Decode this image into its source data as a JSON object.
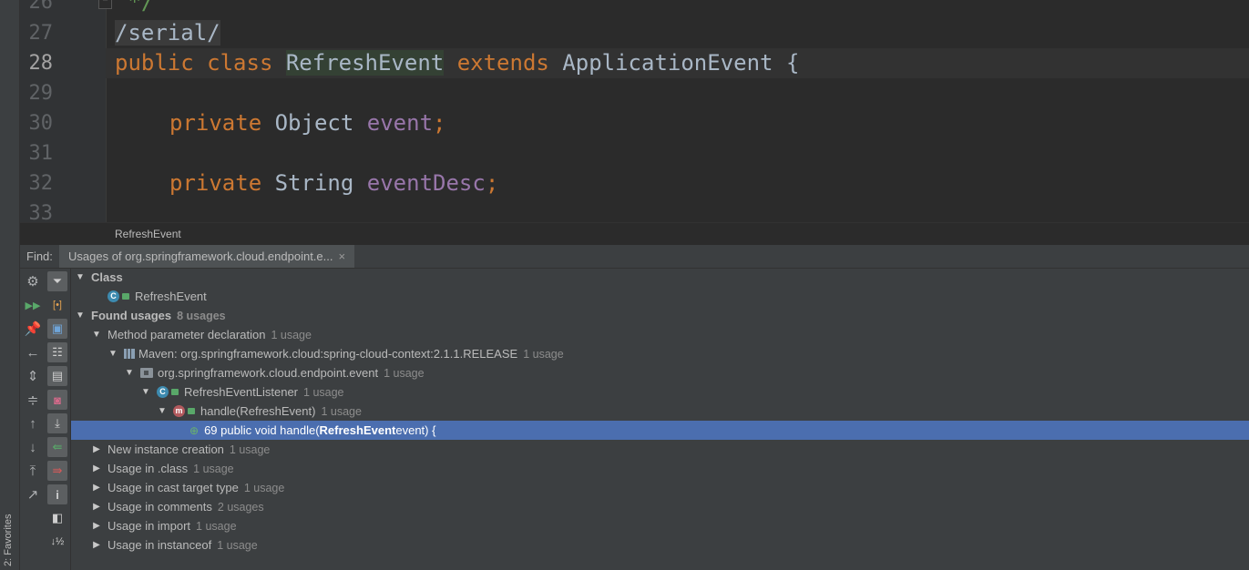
{
  "editor": {
    "lines": [
      {
        "num": "26",
        "text": " */"
      },
      {
        "num": "27",
        "text": "/serial/"
      },
      {
        "num": "28",
        "kw1": "public",
        "kw2": "class",
        "cls": "RefreshEvent",
        "kw3": "extends",
        "parent": "ApplicationEvent",
        "tail": "{"
      },
      {
        "num": "29",
        "text": ""
      },
      {
        "num": "30",
        "kw": "private",
        "type": "Object",
        "field": "event",
        "semi": ";"
      },
      {
        "num": "31",
        "text": ""
      },
      {
        "num": "32",
        "kw": "private",
        "type": "String",
        "field": "eventDesc",
        "semi": ";"
      },
      {
        "num": "33",
        "text": ""
      }
    ]
  },
  "breadcrumb": "RefreshEvent",
  "find": {
    "label": "Find:",
    "tab_label": "Usages of org.springframework.cloud.endpoint.e...",
    "tab_close": "×"
  },
  "toolbar": {
    "col1": [
      "settings-icon",
      "rerun-icon",
      "pin-icon",
      "previous-occurrence-icon",
      "expand-all-icon",
      "collapse-all-icon",
      "up-icon",
      "down-icon",
      "export-icon",
      "open-in-new-tab-icon"
    ],
    "col2": [
      "filter-icon",
      "group-by-usage-type-icon",
      "group-by-module-icon",
      "group-by-package-icon",
      "group-by-file-structure-icon",
      "merge-usages-icon",
      "autoscroll-to-source-icon",
      "autoscroll-from-source-icon",
      "info-icon",
      "preview-icon",
      "sort-icon"
    ]
  },
  "tree": {
    "class_header": "Class",
    "class_item": "RefreshEvent",
    "found_label": "Found usages",
    "found_count": "8 usages",
    "method_param": {
      "label": "Method parameter declaration",
      "count": "1 usage"
    },
    "maven": {
      "label": "Maven: org.springframework.cloud:spring-cloud-context:2.1.1.RELEASE",
      "count": "1 usage"
    },
    "package": {
      "label": "org.springframework.cloud.endpoint.event",
      "count": "1 usage"
    },
    "listener": {
      "label": "RefreshEventListener",
      "count": "1 usage"
    },
    "handle": {
      "label": "handle(RefreshEvent)",
      "count": "1 usage"
    },
    "usage_line": {
      "prefix": "69 public void handle(",
      "bold": "RefreshEvent",
      "suffix": " event) {"
    },
    "groups": [
      {
        "label": "New instance creation",
        "count": "1 usage"
      },
      {
        "label": "Usage in .class",
        "count": "1 usage"
      },
      {
        "label": "Usage in cast target type",
        "count": "1 usage"
      },
      {
        "label": "Usage in comments",
        "count": "2 usages"
      },
      {
        "label": "Usage in import",
        "count": "1 usage"
      },
      {
        "label": "Usage in instanceof",
        "count": "1 usage"
      }
    ]
  },
  "favorites_label": "2: Favorites"
}
